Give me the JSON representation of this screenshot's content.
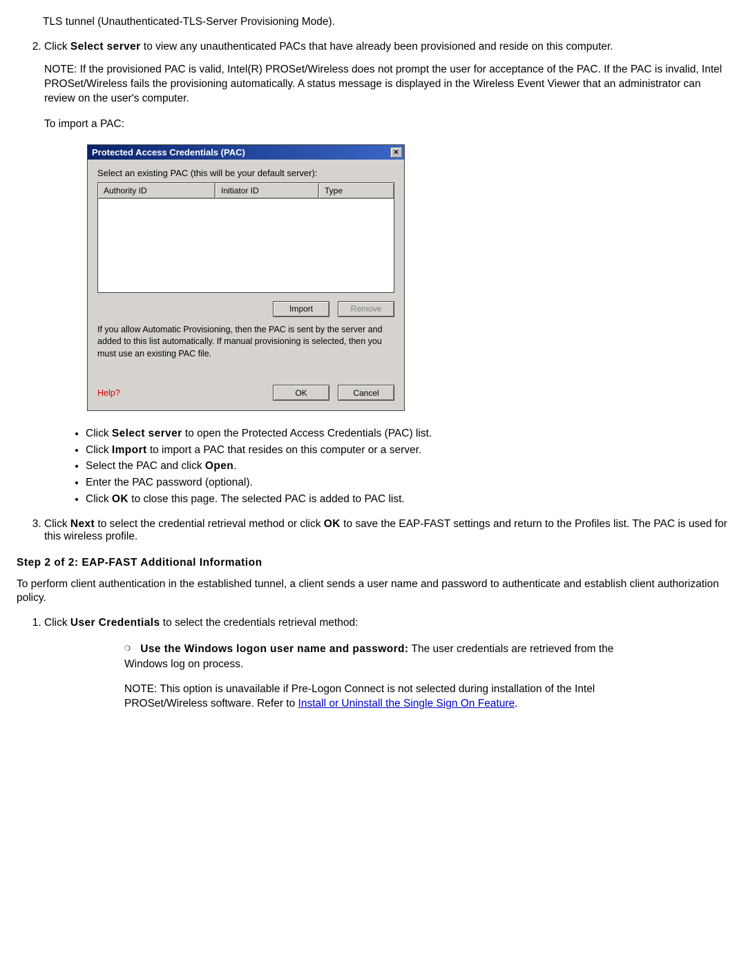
{
  "top_list": {
    "pre_number_line1": "TLS tunnel (Unauthenticated-TLS-Server Provisioning Mode).",
    "item2_a": "Click ",
    "item2_b": "Select server",
    "item2_c": " to view any unauthenticated PACs that have already been provisioned and reside on this computer.",
    "note": "NOTE: If the provisioned PAC is valid, Intel(R) PROSet/Wireless does not prompt the user for acceptance of the PAC. If the PAC is invalid, Intel PROSet/Wireless fails the provisioning automatically. A status message is displayed in the Wireless Event Viewer that an administrator can review on the user's computer.",
    "import_line": "To import a PAC:"
  },
  "dialog": {
    "title": "Protected Access Credentials (PAC)",
    "close": "×",
    "instruction": "Select an existing PAC (this will be your default server):",
    "col1": "Authority ID",
    "col2": "Initiator ID",
    "col3": "Type",
    "import": "Import",
    "remove": "Remove",
    "note": "If you allow Automatic Provisioning, then the PAC is sent by the server and added to this list automatically.  If manual provisioning is selected, then you must use an existing PAC file.",
    "help": "Help?",
    "ok": "OK",
    "cancel": "Cancel"
  },
  "bullets": {
    "b1a": "Click ",
    "b1b": "Select server",
    "b1c": " to open the Protected Access Credentials (PAC) list.",
    "b2a": "Click ",
    "b2b": "Import",
    "b2c": " to import a PAC that resides on this computer or a server.",
    "b3a": "Select the PAC and click ",
    "b3b": "Open",
    "b3c": ".",
    "b4": "Enter the PAC password (optional).",
    "b5a": "Click ",
    "b5b": "OK",
    "b5c": " to close this page. The selected PAC is added to PAC list."
  },
  "item3": {
    "a": "Click ",
    "b": "Next",
    "c": " to select the credential retrieval method or click ",
    "d": "OK",
    "e": " to save the EAP-FAST settings and return to the Profiles list. The PAC is used for this wireless profile."
  },
  "step2": {
    "title": "Step 2 of 2: EAP-FAST Additional Information",
    "intro": "To perform client authentication in the established tunnel, a client sends a user name and password to authenticate and establish client authorization policy.",
    "n1a": "Click ",
    "n1b": "User Credentials",
    "n1c": " to select the credentials retrieval method:",
    "c1a": "Use the Windows logon user name and password:",
    "c1b": " The user credentials are retrieved from the Windows log on process.",
    "c1_note_a": "NOTE: This option is unavailable if Pre-Logon Connect is not selected during installation of the Intel PROSet/Wireless software. Refer to ",
    "c1_note_link": "Install or Uninstall the Single Sign On Feature",
    "c1_note_b": "."
  }
}
